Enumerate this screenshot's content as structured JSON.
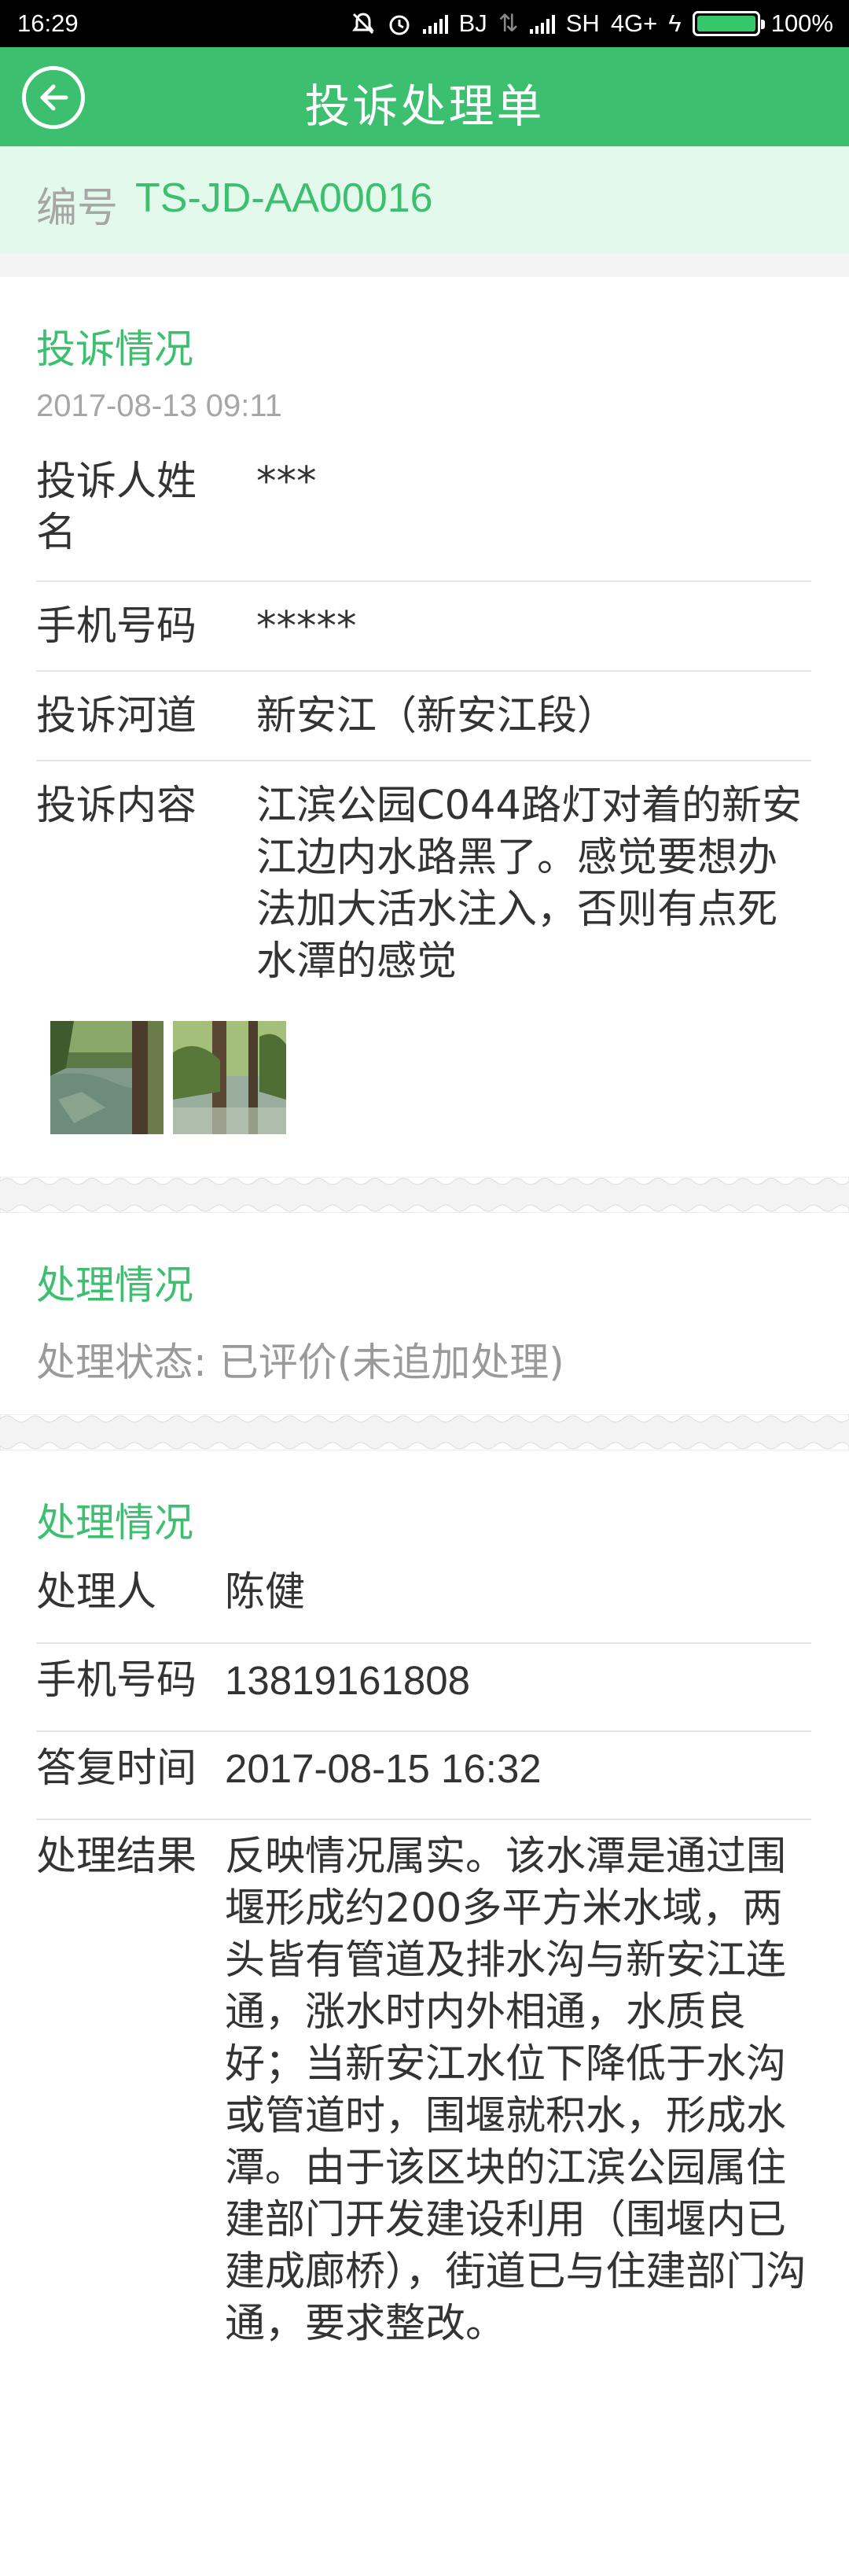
{
  "status_bar": {
    "time": "16:29",
    "carrier1": "BJ",
    "carrier2": "SH",
    "network": "4G+",
    "battery": "100%"
  },
  "app_bar": {
    "title": "投诉处理单",
    "back_icon": "back-arrow-circle-icon"
  },
  "number": {
    "label": "编号",
    "value": "TS-JD-AA00016"
  },
  "complaint": {
    "title": "投诉情况",
    "datetime": "2017-08-13 09:11",
    "rows": [
      {
        "label": "投诉人姓名",
        "value": "***"
      },
      {
        "label": "手机号码",
        "value": "*****"
      },
      {
        "label": "投诉河道",
        "value": "新安江（新安江段）"
      },
      {
        "label": "投诉内容",
        "value": "江滨公园C044路灯对着的新安江边内水路黑了。感觉要想办法加大活水注入，否则有点死水潭的感觉"
      }
    ],
    "photos": [
      "photo-river-1",
      "photo-river-2"
    ]
  },
  "handling_status": {
    "title": "处理情况",
    "status_text": "处理状态: 已评价(未追加处理)"
  },
  "handling_detail": {
    "title": "处理情况",
    "rows": [
      {
        "label": "处理人",
        "value": "陈健"
      },
      {
        "label": "手机号码",
        "value": "13819161808"
      },
      {
        "label": "答复时间",
        "value": "2017-08-15 16:32"
      },
      {
        "label": "处理结果",
        "value": "反映情况属实。该水潭是通过围堰形成约200多平方米水域，两头皆有管道及排水沟与新安江连通，涨水时内外相通，水质良好；当新安江水位下降低于水沟或管道时，围堰就积水，形成水潭。由于该区块的江滨公园属住建部门开发建设利用（围堰内已建成廊桥），街道已与住建部门沟通，要求整改。"
      }
    ]
  },
  "colors": {
    "accent": "#3cc070",
    "number_bg": "#e3f9ec",
    "muted": "#a6a6a6"
  }
}
